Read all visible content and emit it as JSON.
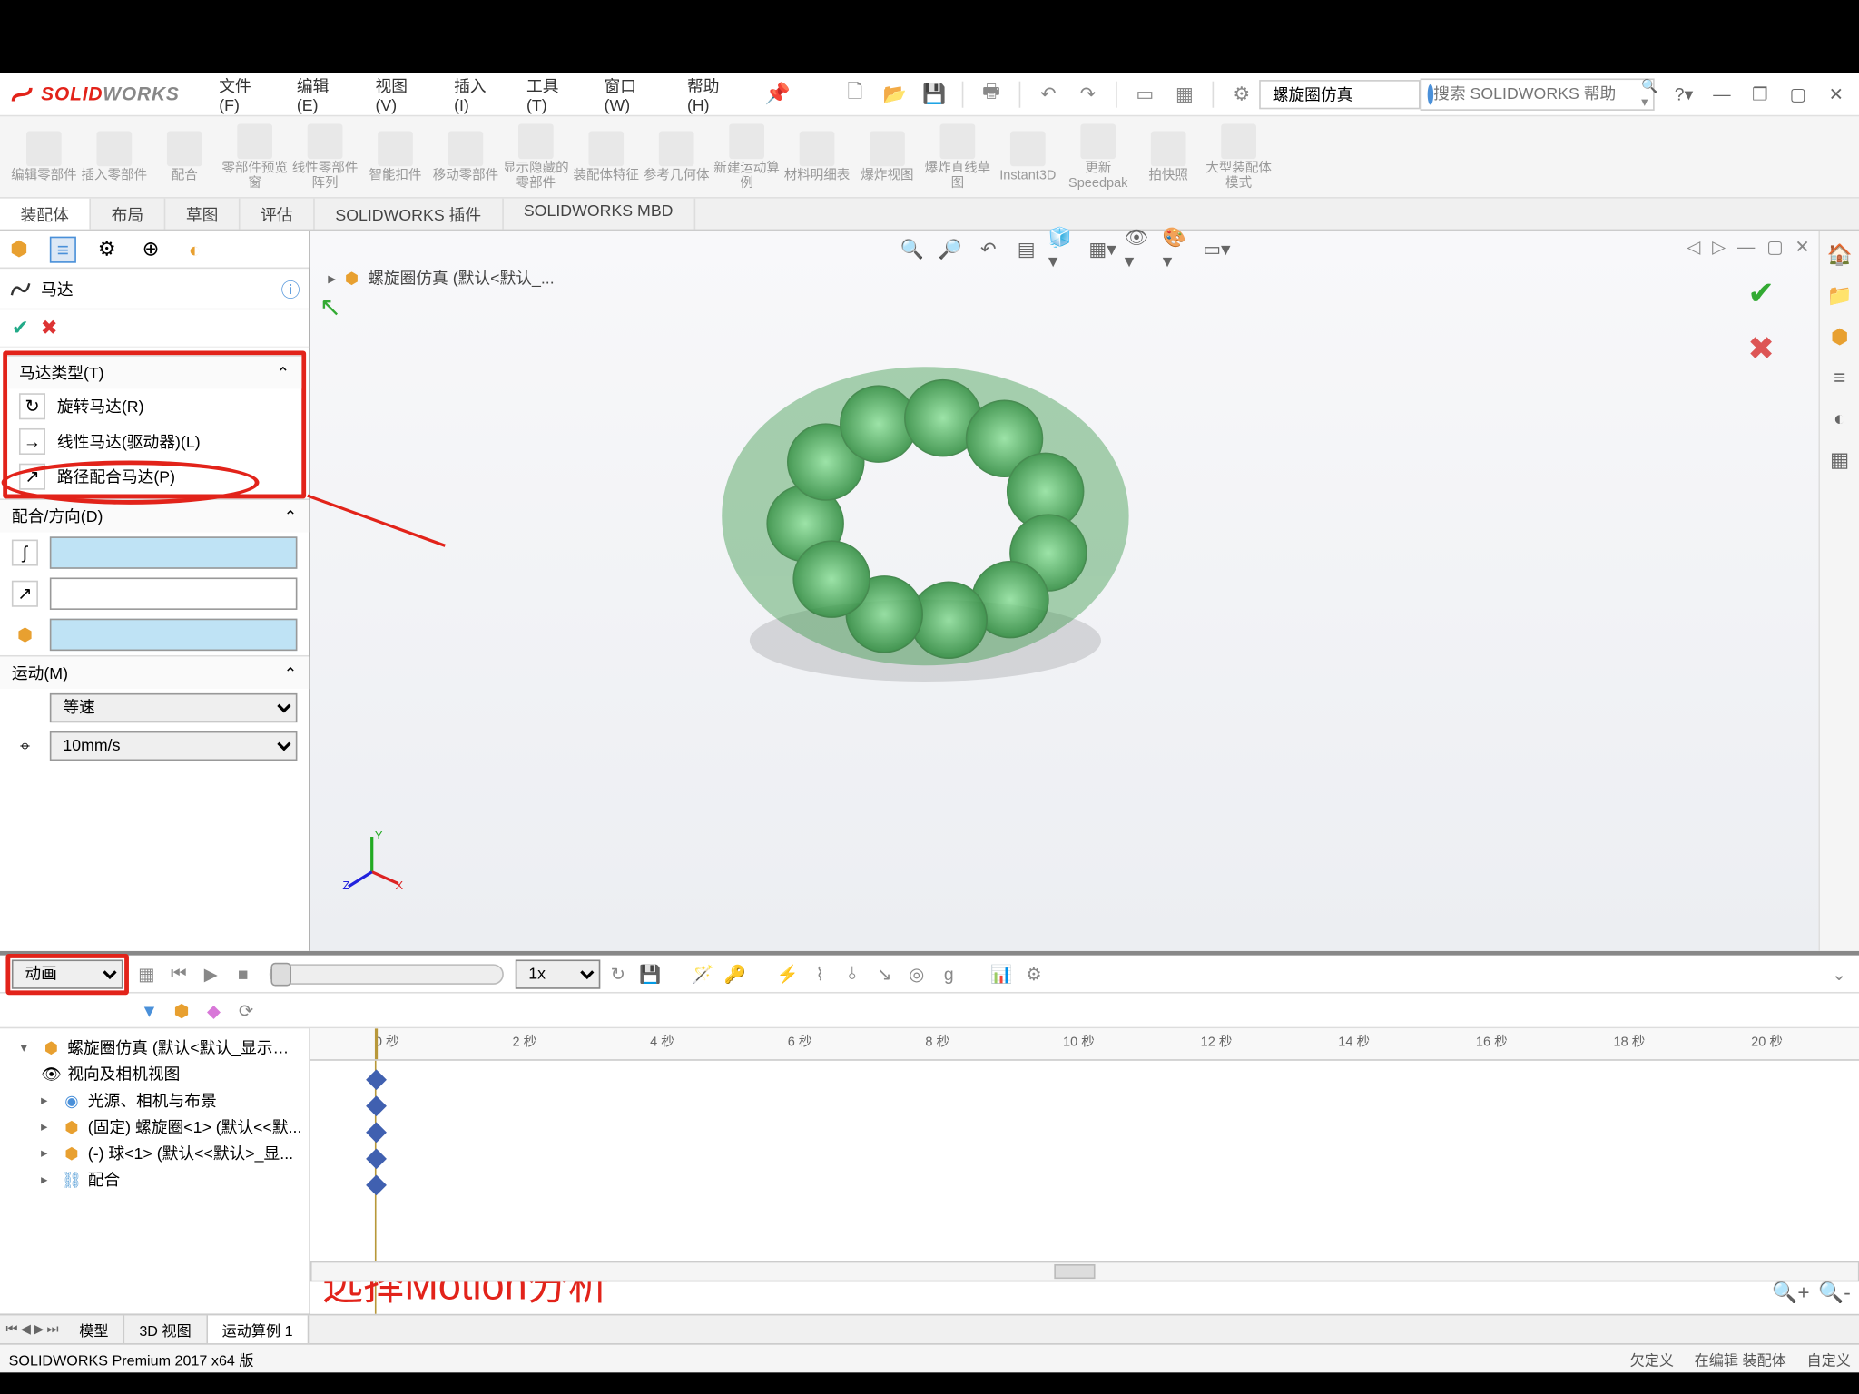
{
  "logo": {
    "brand1": "SOLID",
    "brand2": "WORKS"
  },
  "menu": [
    "文件(F)",
    "编辑(E)",
    "视图(V)",
    "插入(I)",
    "工具(T)",
    "窗口(W)",
    "帮助(H)"
  ],
  "doc_name_input": "螺旋圈仿真",
  "search_placeholder": "搜索 SOLIDWORKS 帮助",
  "ribbon_buttons": [
    "编辑零部件",
    "插入零部件",
    "配合",
    "零部件预览窗",
    "线性零部件阵列",
    "智能扣件",
    "移动零部件",
    "显示隐藏的零部件",
    "装配体特征",
    "参考几何体",
    "新建运动算例",
    "材料明细表",
    "爆炸视图",
    "爆炸直线草图",
    "Instant3D",
    "更新Speedpak",
    "拍快照",
    "大型装配体模式"
  ],
  "command_tabs": [
    "装配体",
    "布局",
    "草图",
    "评估",
    "SOLIDWORKS 插件",
    "SOLIDWORKS MBD"
  ],
  "breadcrumb": "螺旋圈仿真  (默认<默认_...",
  "pm": {
    "title": "马达",
    "sec_type": "马达类型(T)",
    "opt_rotary": "旋转马达(R)",
    "opt_linear": "线性马达(驱动器)(L)",
    "opt_path": "路径配合马达(P)",
    "sec_fit": "配合/方向(D)",
    "sec_motion": "运动(M)",
    "motion_type": "等速",
    "motion_speed": "10mm/s"
  },
  "timeline": {
    "study_combo": "动画",
    "playback_speed": "1x",
    "ruler_marks": [
      "0 秒",
      "2 秒",
      "4 秒",
      "6 秒",
      "8 秒",
      "10 秒",
      "12 秒",
      "14 秒",
      "16 秒",
      "18 秒",
      "20 秒"
    ],
    "tree": {
      "root": "螺旋圈仿真 (默认<默认_显示状态",
      "n1": "视向及相机视图",
      "n2": "光源、相机与布景",
      "n3": "(固定) 螺旋圈<1> (默认<<默...",
      "n4": "(-) 球<1> (默认<<默认>_显...",
      "n5": "配合"
    },
    "tool_row2_icons": [
      "calc-icon",
      "motor-icon",
      "spring-icon",
      "force-icon",
      "contact-icon"
    ]
  },
  "annotation": "选择Motion分析",
  "view_tabs": [
    "模型",
    "3D 视图",
    "运动算例 1"
  ],
  "status": {
    "left": "SOLIDWORKS Premium 2017 x64 版",
    "r1": "欠定义",
    "r2": "在编辑 装配体",
    "r3": "自定义"
  }
}
